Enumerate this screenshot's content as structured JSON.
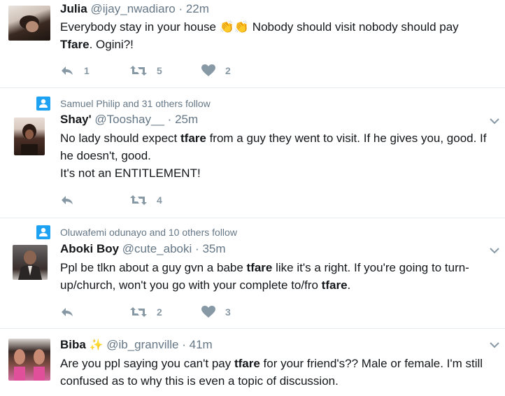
{
  "tweets": [
    {
      "name": "Julia",
      "handle": "@ijay_nwadiaro",
      "sep": "·",
      "time": "22m",
      "text_a": "Everybody stay in your house ",
      "emoji": "👏👏",
      "text_b": " Nobody should visit nobody should pay",
      "text_c_bold": "Tfare",
      "text_d": ". Ogini?!",
      "replies": "1",
      "retweets": "5",
      "likes": "2"
    },
    {
      "context": "Samuel Philip and 31 others follow",
      "name": "Shay'",
      "handle": "@Tooshay__",
      "sep": "·",
      "time": "25m",
      "text_a": "No lady should expect ",
      "bold1": "tfare",
      "text_b": " from a guy they went to visit. If he gives you, good. If he doesn't, good.",
      "text_c": "It's not an ENTITLEMENT!",
      "retweets": "4"
    },
    {
      "context": "Oluwafemi odunayo and 10 others follow",
      "name": "Aboki Boy",
      "handle": "@cute_aboki",
      "sep": "·",
      "time": "35m",
      "text_a": "Ppl be tlkn about a guy gvn a babe ",
      "bold1": "tfare",
      "text_b": " like it's a right. If you're going to turn-up/church, won't you go with your complete to/fro ",
      "bold2": "tfare",
      "text_c": ".",
      "retweets": "2",
      "likes": "3"
    },
    {
      "name": "Biba",
      "sparkle": "✨",
      "handle": "@ib_granville",
      "sep": "·",
      "time": "41m",
      "text_a": "Are you ppl saying you can't pay ",
      "bold1": "tfare",
      "text_b": " for your friend's?? Male or female. I'm still confused as to why this is even a topic of discussion."
    }
  ],
  "colors": {
    "icon_gray": "#8899a6",
    "meta_gray": "#657786",
    "context_blue": "#1da1f2",
    "divider": "#e6ecf0"
  }
}
